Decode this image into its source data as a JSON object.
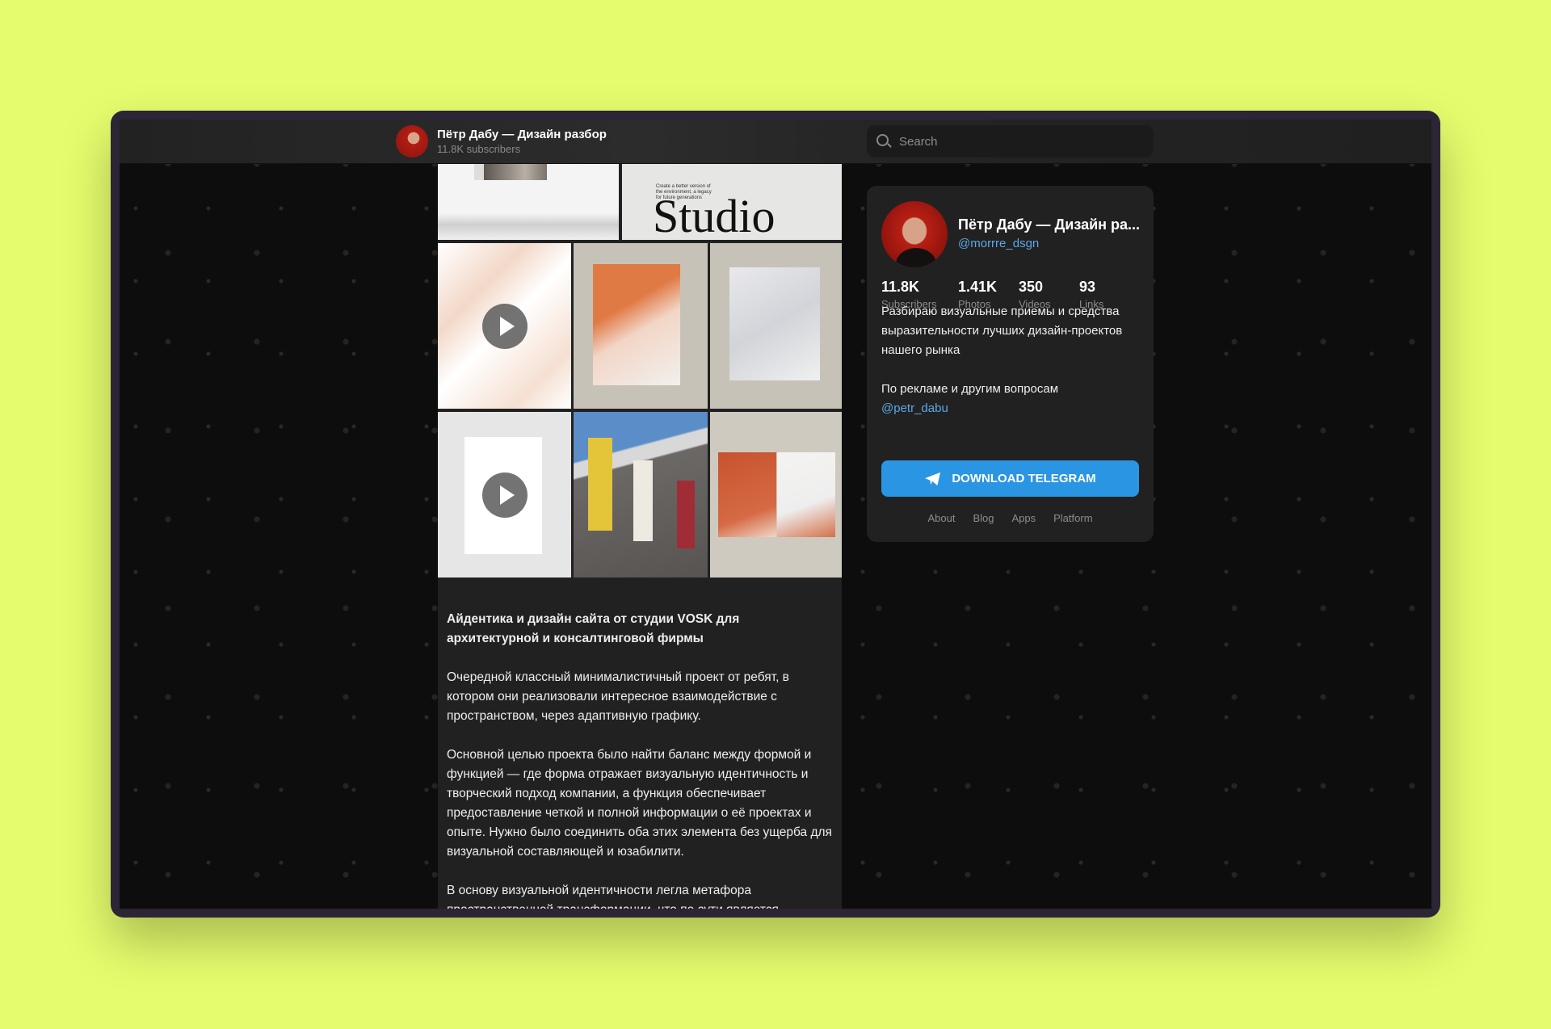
{
  "colors": {
    "background": "#e5fc6d",
    "accent": "#2a95e2",
    "link": "#5ca8e6",
    "panel": "#212121"
  },
  "header": {
    "channel_title": "Пётр Дабу — Дизайн разбор",
    "subscribers": "11.8K subscribers",
    "search_placeholder": "Search"
  },
  "post": {
    "media": [
      {
        "type": "photo",
        "caption_text": ""
      },
      {
        "type": "photo",
        "small_text": "Create a better version of the environment, a legacy for future generations",
        "big_text": "Studio"
      },
      {
        "type": "video"
      },
      {
        "type": "photo"
      },
      {
        "type": "photo"
      },
      {
        "type": "video"
      },
      {
        "type": "photo"
      },
      {
        "type": "photo"
      }
    ],
    "title": "Айдентика и дизайн сайта от студии VOSK для архитектурной и консалтинговой фирмы",
    "paragraphs": [
      "Очередной классный минималистичный проект от ребят, в котором они реализовали интересное взаимодействие с пространством, через адаптивную графику.",
      "Основной целью проекта было найти баланс между формой и функцией — где форма отражает визуальную идентичность и творческий подход компании, а функция обеспечивает предоставление четкой и полной информации о её проектах и опыте. Нужно было соединить оба этих элемента без ущерба для визуальной составляющей и юзабилити.",
      "В основу визуальной идентичности легла метафора пространственной трансформации, что по сути является"
    ]
  },
  "profile": {
    "name": "Пётр Дабу — Дизайн ра...",
    "handle": "@morrre_dsgn",
    "stats": [
      {
        "value": "11.8K",
        "label": "Subscribers"
      },
      {
        "value": "1.41K",
        "label": "Photos"
      },
      {
        "value": "350",
        "label": "Videos"
      },
      {
        "value": "93",
        "label": "Links"
      }
    ],
    "description": "Разбираю визуальные приемы и средства выразительности лучших дизайн-проектов нашего рынка",
    "ad_text": "По рекламе и другим вопросам",
    "ad_handle": "@petr_dabu",
    "button": "DOWNLOAD TELEGRAM",
    "footer_links": [
      "About",
      "Blog",
      "Apps",
      "Platform"
    ]
  }
}
